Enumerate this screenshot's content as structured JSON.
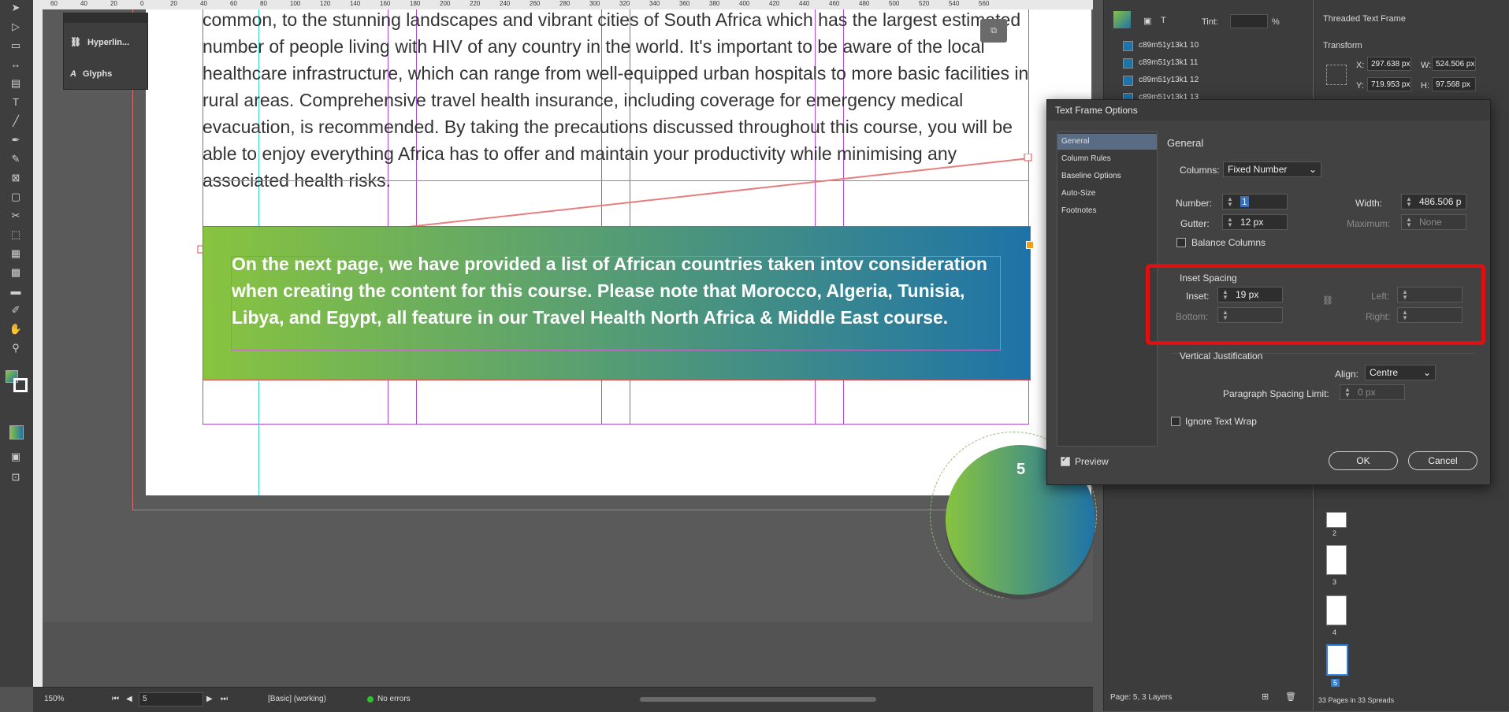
{
  "document": {
    "body_text": "common, to the stunning landscapes and vibrant cities of South Africa which has the largest estimated number of people living with HIV of any country in the world. It's important to be aware of the local healthcare infrastructure, which can range from well-equipped urban hospitals to more basic facilities in rural areas. Comprehensive travel health insurance, including coverage for emergency medical evacuation, is recommended. By taking the precautions discussed throughout this course, you will be able to enjoy everything Africa has to offer and maintain your productivity while minimising any associated health risks.",
    "banner_text": "On the next page, we have provided a list of African countries taken intov consideration when creating the content for this course. Please note that Morocco, Algeria, Tunisia, Libya, and Egypt, all feature in our Travel Health North Africa & Middle East course.",
    "page_number": "5"
  },
  "ruler_ticks": [
    "60",
    "40",
    "20",
    "0",
    "20",
    "40",
    "60",
    "80",
    "100",
    "120",
    "140",
    "160",
    "180",
    "200",
    "220",
    "240",
    "260",
    "280",
    "300",
    "320",
    "340",
    "360",
    "380",
    "400",
    "420",
    "440",
    "460",
    "480",
    "500",
    "520",
    "540",
    "560"
  ],
  "mini_panel": {
    "hyperlinks": "Hyperlin...",
    "glyphs": "Glyphs"
  },
  "statusbar": {
    "zoom": "150%",
    "page": "5",
    "style": "[Basic] (working)",
    "preflight": "No errors"
  },
  "swatches": {
    "tint_label": "Tint:",
    "tint_unit": "%",
    "items": [
      "c89m51y13k1 10",
      "c89m51y13k1 11",
      "c89m51y13k1 12",
      "c89m51y13k1 13"
    ],
    "footer": "Page: 5, 3 Layers"
  },
  "properties": {
    "title": "Threaded Text Frame",
    "transform": "Transform",
    "x": "297.638 px",
    "y": "719.953 px",
    "w": "524.506 px",
    "h": "97.568 px",
    "x_label": "X:",
    "y_label": "Y:",
    "w_label": "W:",
    "h_label": "H:",
    "pages": [
      "2",
      "3",
      "4",
      "5"
    ],
    "pages_footer": "33 Pages in 33 Spreads"
  },
  "dialog": {
    "title": "Text Frame Options",
    "nav": [
      "General",
      "Column Rules",
      "Baseline Options",
      "Auto-Size",
      "Footnotes"
    ],
    "section_title": "General",
    "columns_label": "Columns:",
    "columns_value": "Fixed Number",
    "number_label": "Number:",
    "number_value": "1",
    "gutter_label": "Gutter:",
    "gutter_value": "12 px",
    "width_label": "Width:",
    "width_value": "486.506 p",
    "maximum_label": "Maximum:",
    "maximum_value": "None",
    "balance_columns": "Balance Columns",
    "inset_title": "Inset Spacing",
    "inset_label": "Inset:",
    "inset_value": "19 px",
    "bottom_label": "Bottom:",
    "left_label": "Left:",
    "right_label": "Right:",
    "vj_title": "Vertical Justification",
    "align_label": "Align:",
    "align_value": "Centre",
    "psl_label": "Paragraph Spacing Limit:",
    "psl_value": "0 px",
    "ignore_wrap": "Ignore Text Wrap",
    "preview": "Preview",
    "ok": "OK",
    "cancel": "Cancel"
  }
}
